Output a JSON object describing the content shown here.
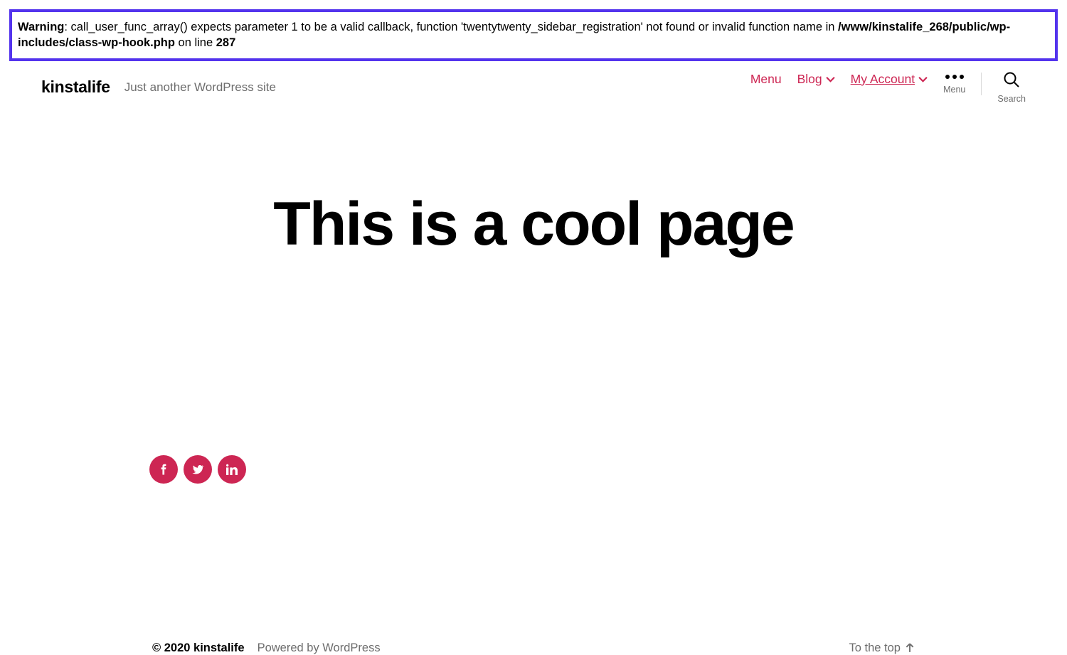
{
  "warning": {
    "label": "Warning",
    "message": ": call_user_func_array() expects parameter 1 to be a valid callback, function 'twentytwenty_sidebar_registration' not found or invalid function name in ",
    "file": "/www/kinstalife_268/public/wp-includes/class-wp-hook.php",
    "on_line_text": " on line ",
    "line_number": "287"
  },
  "header": {
    "site_title": "kinstalife",
    "tagline": "Just another WordPress site",
    "nav": [
      {
        "label": "Menu",
        "has_dropdown": false,
        "underline": false
      },
      {
        "label": "Blog",
        "has_dropdown": true,
        "underline": false
      },
      {
        "label": "My Account",
        "has_dropdown": true,
        "underline": true
      }
    ],
    "menu_button_label": "Menu",
    "search_button_label": "Search"
  },
  "page": {
    "heading": "This is a cool page"
  },
  "social": [
    {
      "name": "facebook"
    },
    {
      "name": "twitter"
    },
    {
      "name": "linkedin"
    }
  ],
  "footer": {
    "copyright": "© 2020 kinstalife",
    "powered_by": "Powered by WordPress",
    "to_top": "To the top"
  }
}
